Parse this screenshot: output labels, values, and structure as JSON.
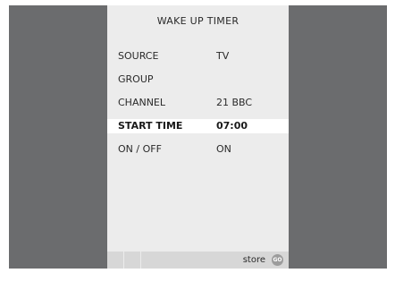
{
  "screen": {
    "title": "WAKE UP TIMER"
  },
  "rows": [
    {
      "label": "SOURCE",
      "value": "TV",
      "selected": false
    },
    {
      "label": "GROUP",
      "value": "",
      "selected": false
    },
    {
      "label": "CHANNEL",
      "value": "21  BBC",
      "selected": false
    },
    {
      "label": "START TIME",
      "value": "07:00",
      "selected": true
    },
    {
      "label": "ON / OFF",
      "value": "ON",
      "selected": false
    }
  ],
  "status_bar": {
    "store_label": "store",
    "go_icon": "go-button-icon",
    "go_text": "GO"
  }
}
